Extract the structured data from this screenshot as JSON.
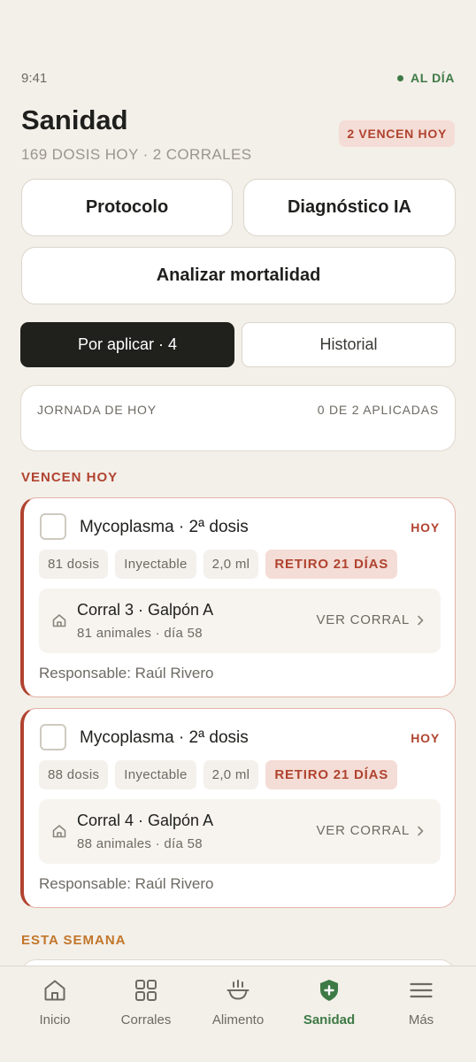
{
  "status_bar": {
    "time": "9:41",
    "sync_label": "AL DÍA",
    "sync_color": "#3d7a45"
  },
  "header": {
    "title": "Sanidad",
    "subtitle": "169 DOSIS HOY · 2 CORRALES",
    "due_badge": "2 VENCEN HOY"
  },
  "actions": {
    "protocolo": "Protocolo",
    "diagnostico": "Diagnóstico IA",
    "mortalidad": "Analizar mortalidad"
  },
  "tabs": {
    "active": "Por aplicar · 4",
    "inactive": "Historial"
  },
  "jornada": {
    "label": "JORNADA DE HOY",
    "count": "0 DE 2 APLICADAS"
  },
  "sections": {
    "due_today": "VENCEN HOY",
    "this_week": "ESTA SEMANA"
  },
  "cards": [
    {
      "title": "Mycoplasma · 2ª dosis",
      "when": "HOY",
      "doses": "81 dosis",
      "route": "Inyectable",
      "volume": "2,0 ml",
      "withdrawal": "RETIRO 21 DÍAS",
      "corral": "Corral 3 · Galpón A",
      "corral_detail": "81 animales · día 58",
      "ver_corral": "VER CORRAL",
      "responsable": "Responsable: Raúl Rivero"
    },
    {
      "title": "Mycoplasma · 2ª dosis",
      "when": "HOY",
      "doses": "88 dosis",
      "route": "Inyectable",
      "volume": "2,0 ml",
      "withdrawal": "RETIRO 21 DÍAS",
      "corral": "Corral 4 · Galpón A",
      "corral_detail": "88 animales · día 58",
      "ver_corral": "VER CORRAL",
      "responsable": "Responsable: Raúl Rivero"
    }
  ],
  "nav": {
    "items": [
      {
        "label": "Inicio",
        "icon": "home-icon"
      },
      {
        "label": "Corrales",
        "icon": "grid-icon"
      },
      {
        "label": "Alimento",
        "icon": "feed-bowl-icon"
      },
      {
        "label": "Sanidad",
        "icon": "shield-plus-icon"
      },
      {
        "label": "Más",
        "icon": "menu-icon"
      }
    ],
    "active_index": 3,
    "active_color": "#3d7a45"
  },
  "colors": {
    "background": "#f3efe9",
    "alert": "#b0432f",
    "warning": "#c2762a",
    "dark": "#20211d"
  }
}
